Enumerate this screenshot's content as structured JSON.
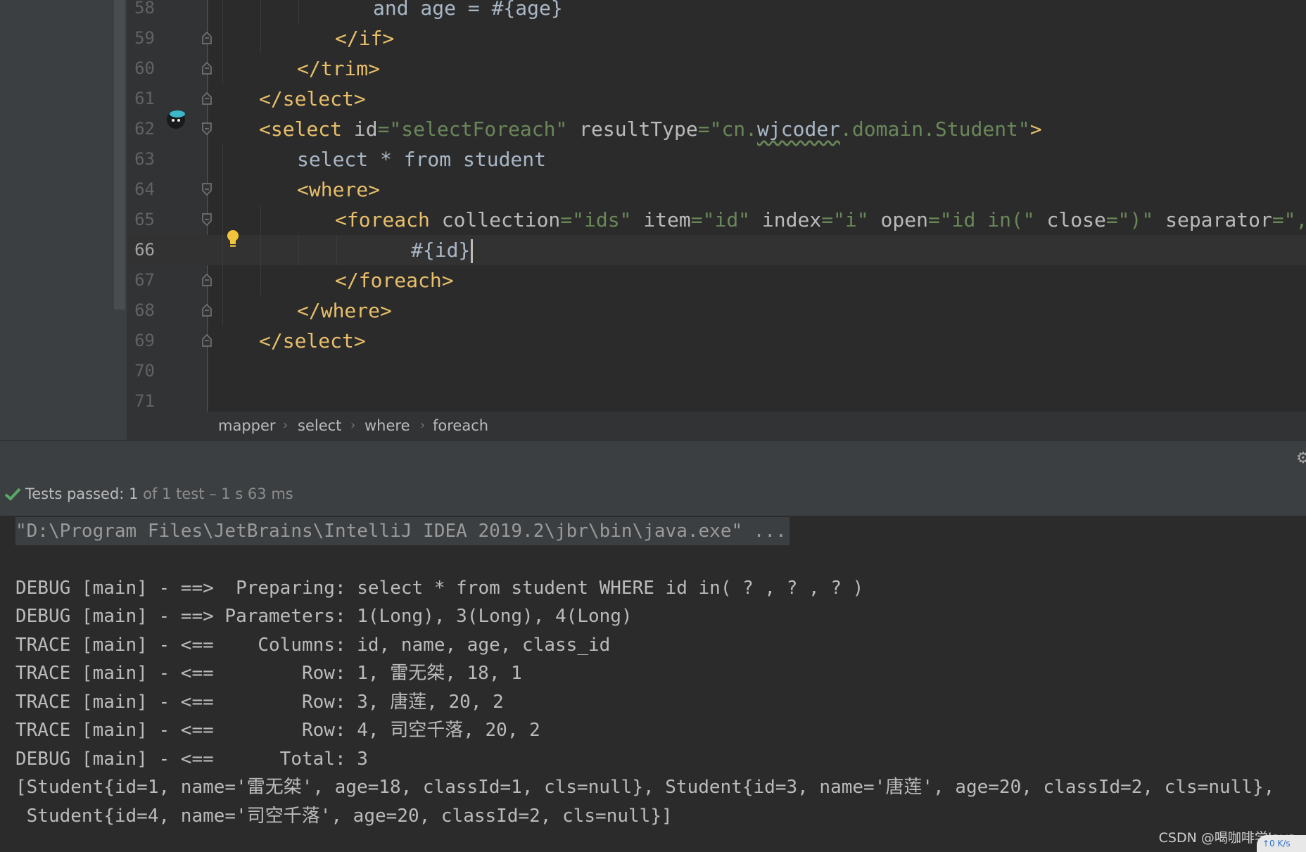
{
  "editor": {
    "lines": [
      {
        "num": "58",
        "indent": 4,
        "parts": [
          {
            "t": "txt",
            "v": "and age = #{age}"
          }
        ]
      },
      {
        "num": "59",
        "indent": 3,
        "parts": [
          {
            "t": "tag",
            "v": "</if>"
          }
        ]
      },
      {
        "num": "60",
        "indent": 2,
        "parts": [
          {
            "t": "tag",
            "v": "</trim>"
          }
        ]
      },
      {
        "num": "61",
        "indent": 1,
        "parts": [
          {
            "t": "tag",
            "v": "</select>"
          }
        ]
      },
      {
        "num": "62",
        "indent": 1,
        "parts": [
          {
            "t": "tag",
            "v": "<select "
          },
          {
            "t": "attr",
            "v": "id"
          },
          {
            "t": "val",
            "v": "=\"selectForeach\" "
          },
          {
            "t": "attr",
            "v": "resultType"
          },
          {
            "t": "val",
            "v": "=\"cn."
          },
          {
            "t": "typo",
            "v": "wjcoder"
          },
          {
            "t": "val",
            "v": ".domain.Student\""
          },
          {
            "t": "tag",
            "v": ">"
          }
        ]
      },
      {
        "num": "63",
        "indent": 2,
        "parts": [
          {
            "t": "txt",
            "v": "select * from student"
          }
        ]
      },
      {
        "num": "64",
        "indent": 2,
        "parts": [
          {
            "t": "tag",
            "v": "<where>"
          }
        ]
      },
      {
        "num": "65",
        "indent": 3,
        "parts": [
          {
            "t": "tag",
            "v": "<foreach "
          },
          {
            "t": "attr",
            "v": "collection"
          },
          {
            "t": "val",
            "v": "=\"ids\" "
          },
          {
            "t": "attr",
            "v": "item"
          },
          {
            "t": "val",
            "v": "=\"id\" "
          },
          {
            "t": "attr",
            "v": "index"
          },
          {
            "t": "val",
            "v": "=\"i\" "
          },
          {
            "t": "attr",
            "v": "open"
          },
          {
            "t": "val",
            "v": "=\"id in(\" "
          },
          {
            "t": "attr",
            "v": "close"
          },
          {
            "t": "val",
            "v": "=\")\" "
          },
          {
            "t": "attr",
            "v": "separator"
          },
          {
            "t": "val",
            "v": "=\",\""
          },
          {
            "t": "tag",
            "v": ">"
          }
        ]
      },
      {
        "num": "66",
        "indent": 5,
        "current": true,
        "parts": [
          {
            "t": "txt",
            "v": "#{id}"
          }
        ]
      },
      {
        "num": "67",
        "indent": 3,
        "parts": [
          {
            "t": "tag",
            "v": "</foreach>"
          }
        ]
      },
      {
        "num": "68",
        "indent": 2,
        "parts": [
          {
            "t": "tag",
            "v": "</where>"
          }
        ]
      },
      {
        "num": "69",
        "indent": 1,
        "parts": [
          {
            "t": "tag",
            "v": "</select>"
          }
        ]
      },
      {
        "num": "70",
        "indent": 0,
        "parts": []
      },
      {
        "num": "71",
        "indent": 0,
        "parts": []
      }
    ]
  },
  "breadcrumb": [
    "mapper",
    "select",
    "where",
    "foreach"
  ],
  "run": {
    "status_label": "Tests passed:",
    "passed_count": "1",
    "detail": "of 1 test – 1 s 63 ms"
  },
  "console": {
    "command": "\"D:\\Program Files\\JetBrains\\IntelliJ IDEA 2019.2\\jbr\\bin\\java.exe\" ...",
    "lines": [
      "",
      "DEBUG [main] - ==>  Preparing: select * from student WHERE id in( ? , ? , ? )",
      "DEBUG [main] - ==> Parameters: 1(Long), 3(Long), 4(Long)",
      "TRACE [main] - <==    Columns: id, name, age, class_id",
      "TRACE [main] - <==        Row: 1, 雷无桀, 18, 1",
      "TRACE [main] - <==        Row: 3, 唐莲, 20, 2",
      "TRACE [main] - <==        Row: 4, 司空千落, 20, 2",
      "DEBUG [main] - <==      Total: 3",
      "[Student{id=1, name='雷无桀', age=18, classId=1, cls=null}, Student{id=3, name='唐莲', age=20, classId=2, cls=null},",
      " Student{id=4, name='司空千落', age=20, classId=2, cls=null}]"
    ]
  },
  "watermark": "CSDN @喝咖啡学Java",
  "corner": "↑0 K/s",
  "colors": {
    "tag": "#e8bf6a",
    "attr": "#bababa",
    "value": "#6a8759",
    "text": "#a9b7c6",
    "pass": "#59a869"
  }
}
